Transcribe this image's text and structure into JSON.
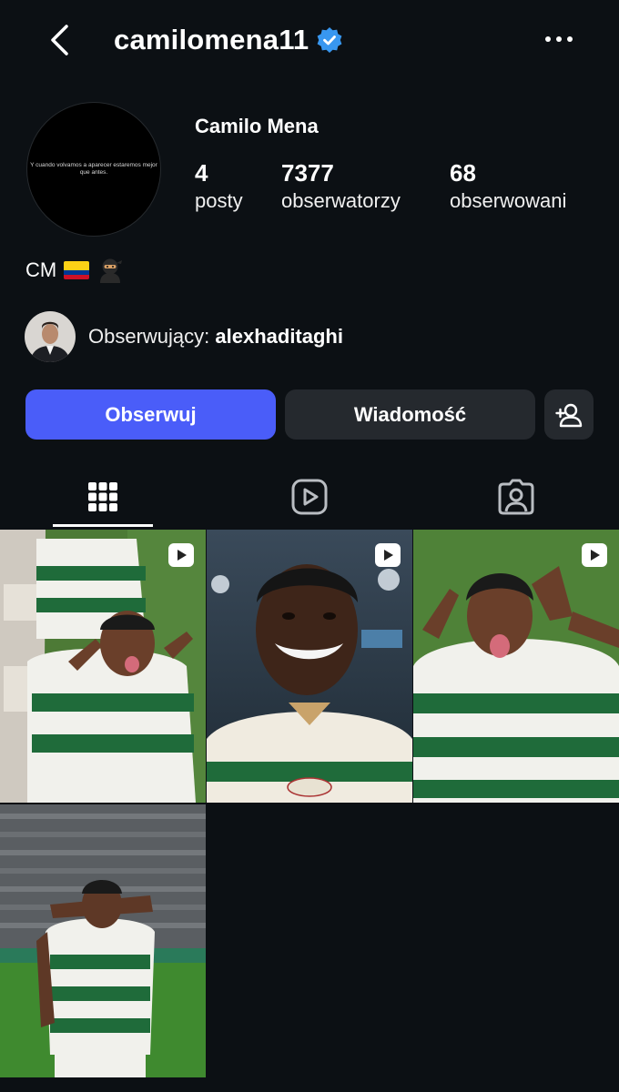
{
  "header": {
    "username": "camilomena11",
    "verified": true,
    "back_icon": "chevron-left-icon",
    "more_icon": "more-horizontal-icon"
  },
  "profile": {
    "avatar_text": "Y cuando volvamos a aparecer estaremos mejor que antes.",
    "display_name": "Camilo Mena",
    "stats": [
      {
        "value": "4",
        "label": "posty"
      },
      {
        "value": "7377",
        "label": "obserwatorzy"
      },
      {
        "value": "68",
        "label": "obserwowani"
      }
    ],
    "bio": "CM",
    "bio_emojis": [
      "colombia-flag",
      "ninja"
    ]
  },
  "followed_by": {
    "prefix": "Obserwujący: ",
    "user": "alexhaditaghi"
  },
  "actions": {
    "follow_label": "Obserwuj",
    "message_label": "Wiadomość",
    "add_user_icon": "person-add-icon"
  },
  "tabs": [
    {
      "icon": "grid-icon",
      "active": true
    },
    {
      "icon": "reels-icon",
      "active": false
    },
    {
      "icon": "tagged-icon",
      "active": false
    }
  ],
  "posts": [
    {
      "type": "reel",
      "description": "player in green-white striped kit celebrating, tongue out"
    },
    {
      "type": "reel",
      "description": "smiling player close-up in stadium"
    },
    {
      "type": "reel",
      "description": "player celebrating with hands at head"
    },
    {
      "type": "photo",
      "description": "player covering face with arm on pitch"
    }
  ],
  "colors": {
    "background": "#0c1014",
    "follow_button": "#4a5df9",
    "secondary_button": "#25292e",
    "verified_badge": "#3897f0"
  }
}
